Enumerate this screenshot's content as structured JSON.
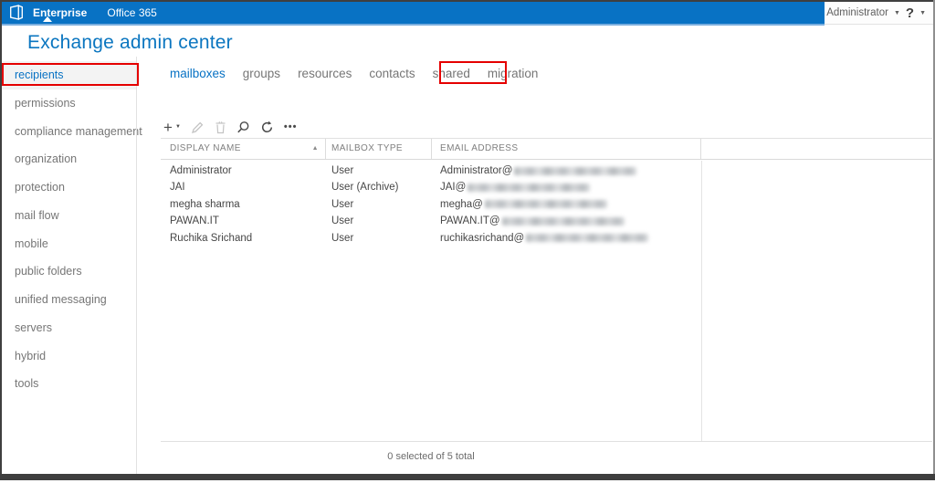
{
  "colors": {
    "topbar_blue": "#0872c4",
    "accent_blue": "#0872c4",
    "annotation_red": "#e50000"
  },
  "icons": {
    "caret_down": "▼",
    "sort_asc": "▲",
    "add": "+",
    "more": "•••"
  },
  "topbar": {
    "nav": [
      {
        "label": "Enterprise",
        "active": true
      },
      {
        "label": "Office 365",
        "active": false
      }
    ],
    "account": {
      "label": "Administrator"
    },
    "help": {
      "label": "?"
    }
  },
  "header": {
    "title": "Exchange admin center"
  },
  "sidebar": {
    "items": [
      {
        "label": "recipients",
        "selected": true,
        "annotated": true
      },
      {
        "label": "permissions"
      },
      {
        "label": "compliance management"
      },
      {
        "label": "organization"
      },
      {
        "label": "protection"
      },
      {
        "label": "mail flow"
      },
      {
        "label": "mobile"
      },
      {
        "label": "public folders"
      },
      {
        "label": "unified messaging"
      },
      {
        "label": "servers"
      },
      {
        "label": "hybrid"
      },
      {
        "label": "tools"
      }
    ]
  },
  "tabs": [
    {
      "label": "mailboxes",
      "selected": true
    },
    {
      "label": "groups"
    },
    {
      "label": "resources"
    },
    {
      "label": "contacts"
    },
    {
      "label": "shared"
    },
    {
      "label": "migration",
      "annotated": true
    }
  ],
  "toolbar": {
    "buttons": [
      "new",
      "edit",
      "delete",
      "search",
      "refresh",
      "more"
    ]
  },
  "list": {
    "columns": [
      {
        "label": "DISPLAY NAME",
        "sort": "asc"
      },
      {
        "label": "MAILBOX TYPE"
      },
      {
        "label": "EMAIL ADDRESS"
      }
    ],
    "rows": [
      {
        "display_name": "Administrator",
        "mailbox_type": "User",
        "email_prefix": "Administrator@",
        "email_domain_redacted": true
      },
      {
        "display_name": "JAI",
        "mailbox_type": "User (Archive)",
        "email_prefix": "JAI@",
        "email_domain_redacted": true
      },
      {
        "display_name": "megha sharma",
        "mailbox_type": "User",
        "email_prefix": "megha@",
        "email_domain_redacted": true
      },
      {
        "display_name": "PAWAN.IT",
        "mailbox_type": "User",
        "email_prefix": "PAWAN.IT@",
        "email_domain_redacted": true
      },
      {
        "display_name": "Ruchika Srichand",
        "mailbox_type": "User",
        "email_prefix": "ruchikasrichand@",
        "email_domain_redacted": true
      }
    ],
    "status": "0 selected of 5 total"
  }
}
